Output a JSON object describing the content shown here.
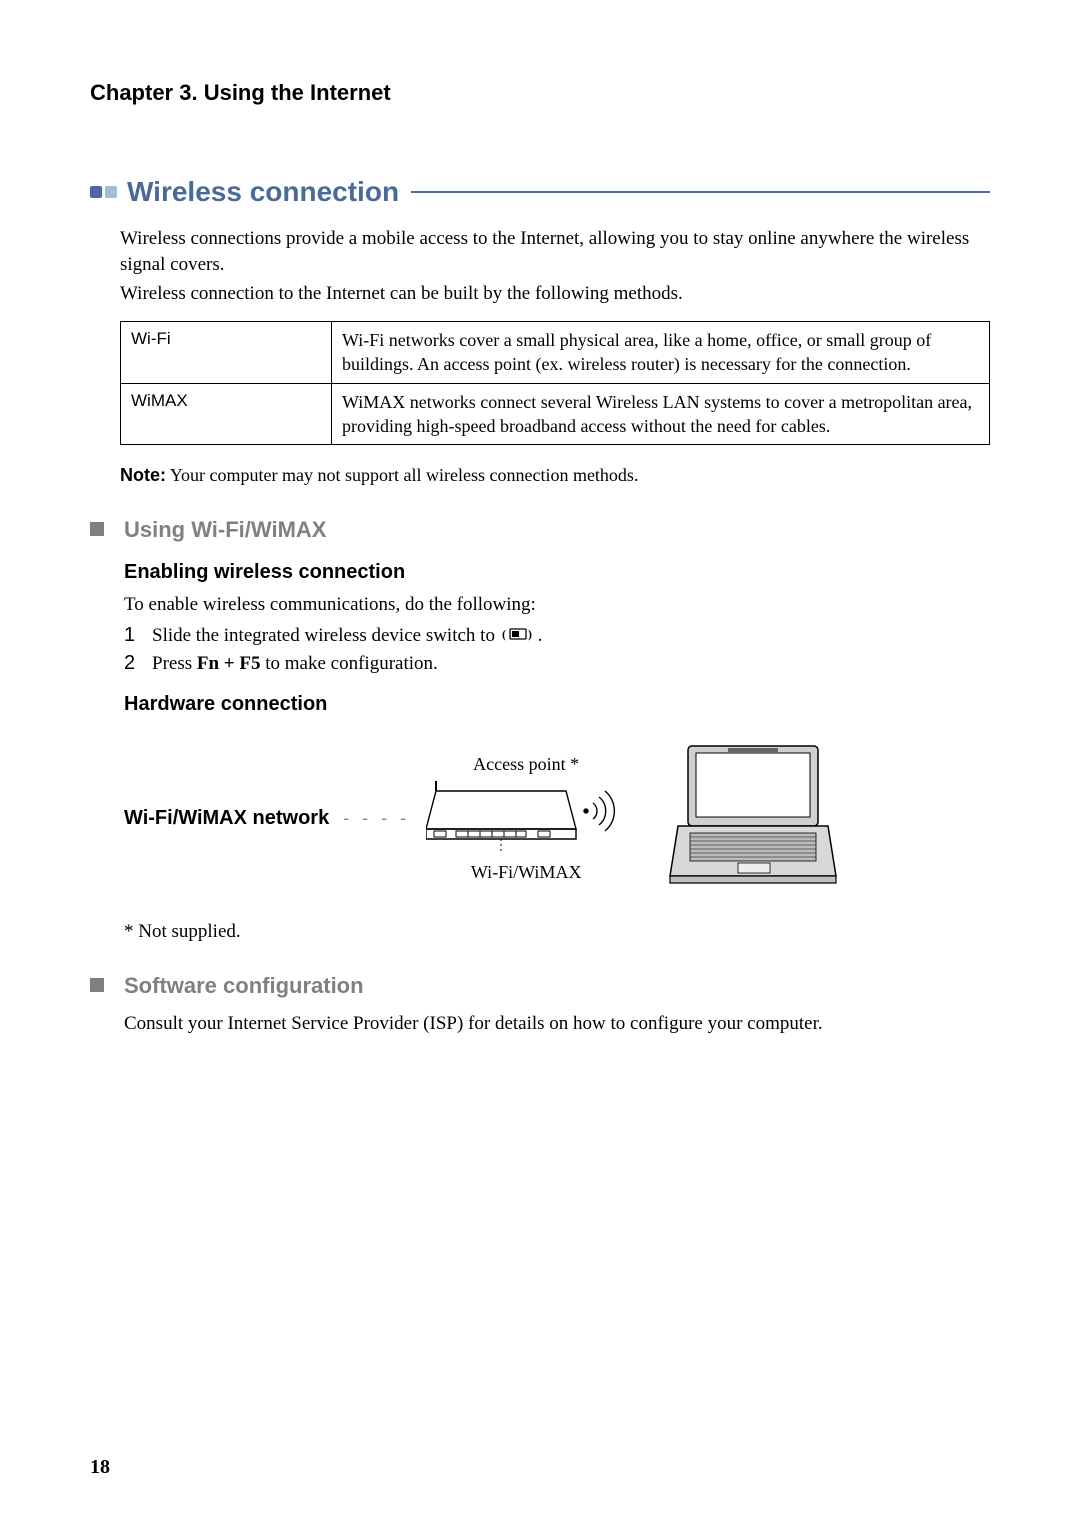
{
  "chapter_header": "Chapter 3. Using the Internet",
  "section": {
    "title": "Wireless connection",
    "intro_p1": "Wireless connections provide a mobile access to the Internet, allowing you to stay online anywhere the wireless signal covers.",
    "intro_p2": "Wireless connection to the Internet can be built by the following methods.",
    "table": [
      {
        "key": "Wi-Fi",
        "desc": "Wi-Fi networks cover a small physical area, like a home, office, or small group of buildings. An access point (ex. wireless router) is necessary for the connection."
      },
      {
        "key": "WiMAX",
        "desc": "WiMAX networks connect several Wireless LAN systems to cover a metropolitan area, providing high-speed broadband access without the need for cables."
      }
    ],
    "note_label": "Note:",
    "note_text": "Your computer may not support all wireless connection methods."
  },
  "sub1": {
    "title": "Using Wi-Fi/WiMAX",
    "heading_enable": "Enabling wireless connection",
    "enable_intro": "To enable wireless communications, do the following:",
    "steps": [
      {
        "num": "1",
        "text_before": "Slide the integrated wireless device switch to ",
        "text_after": "."
      },
      {
        "num": "2",
        "text_before": "Press ",
        "bold": "Fn + F5",
        "text_after": " to make configuration."
      }
    ],
    "heading_hardware": "Hardware connection",
    "diagram": {
      "network_label": "Wi-Fi/WiMAX network",
      "dash": "- - - -",
      "ap_top": "Access point *",
      "ap_bottom": "Wi-Fi/WiMAX"
    },
    "footnote": "* Not supplied."
  },
  "sub2": {
    "title": "Software configuration",
    "text": "Consult your Internet Service Provider (ISP) for details on how to configure your computer."
  },
  "page_number": "18"
}
